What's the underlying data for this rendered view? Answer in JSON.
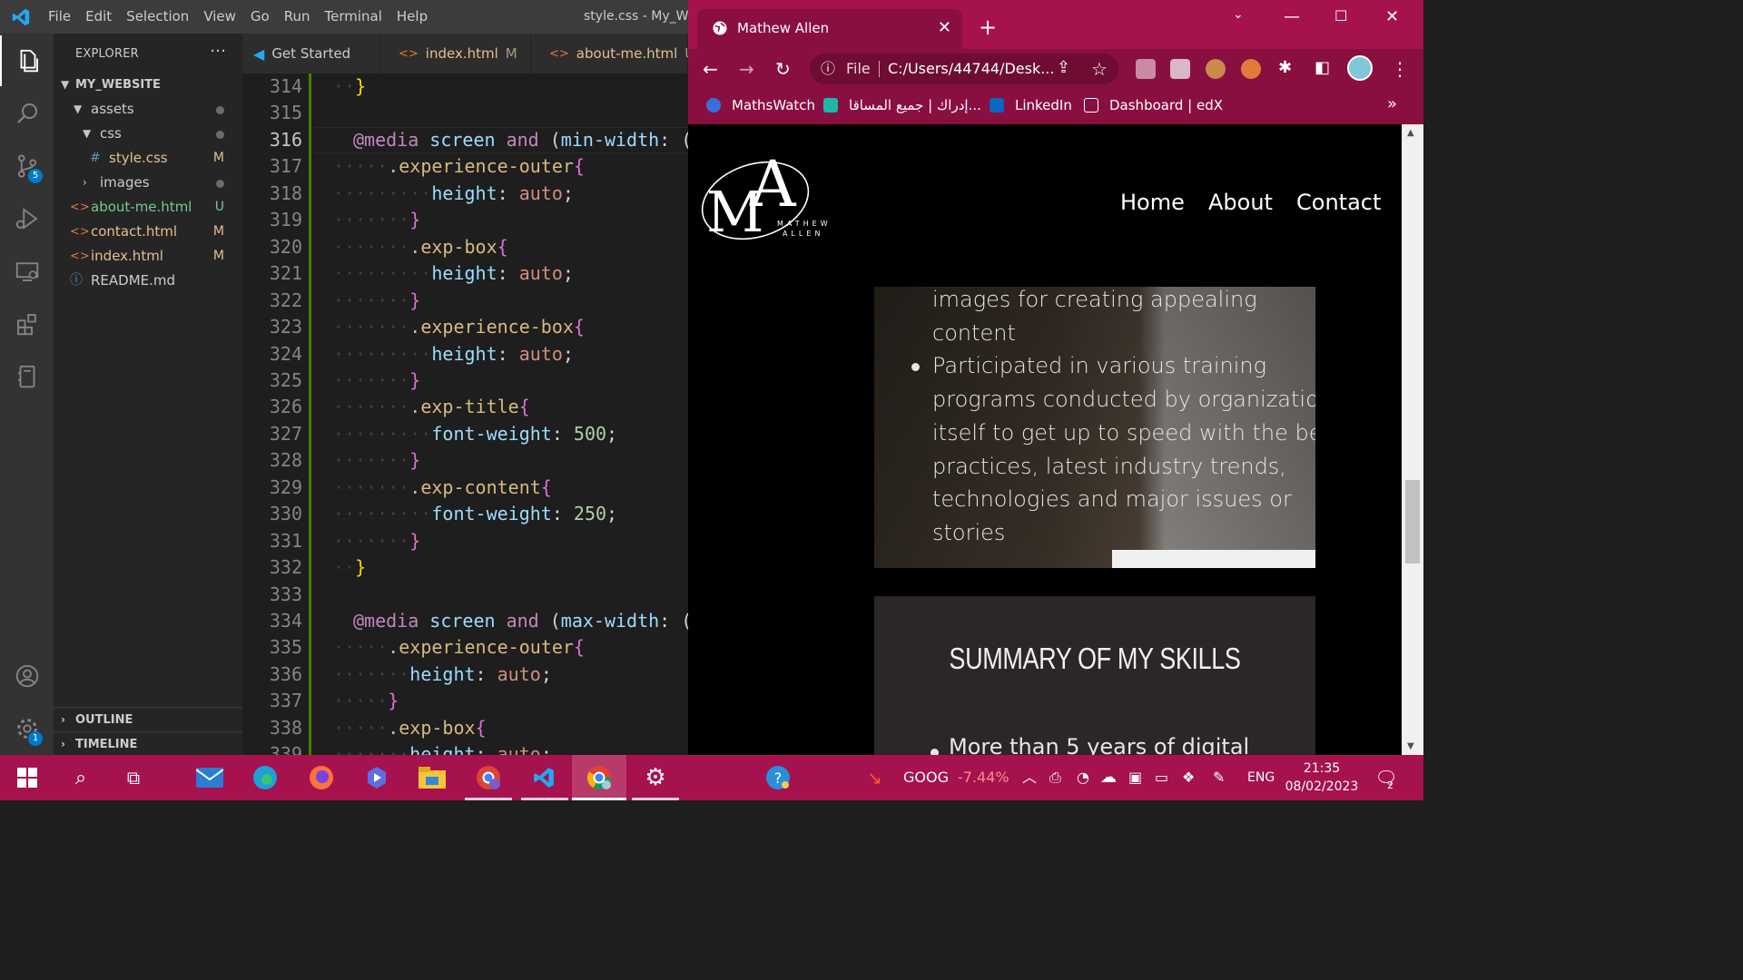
{
  "vscode": {
    "menu": [
      "File",
      "Edit",
      "Selection",
      "View",
      "Go",
      "Run",
      "Terminal",
      "Help"
    ],
    "window_title": "style.css - My_We",
    "explorer_title": "EXPLORER",
    "explorer_more": "···",
    "scm_badge": "5",
    "settings_badge": "1",
    "tree": [
      {
        "label": "MY_WEBSITE",
        "status": ""
      },
      {
        "label": "assets",
        "status": ""
      },
      {
        "label": "css",
        "status": ""
      },
      {
        "label": "style.css",
        "status": "M"
      },
      {
        "label": "images",
        "status": ""
      },
      {
        "label": "about-me.html",
        "status": "U"
      },
      {
        "label": "contact.html",
        "status": "M"
      },
      {
        "label": "index.html",
        "status": "M"
      },
      {
        "label": "README.md",
        "status": ""
      }
    ],
    "sections": [
      "OUTLINE",
      "TIMELINE"
    ],
    "tabs": [
      {
        "label": "Get Started",
        "status": ""
      },
      {
        "label": "index.html",
        "status": "M"
      },
      {
        "label": "about-me.html",
        "status": "U"
      }
    ],
    "line_numbers": [
      "314",
      "315",
      "316",
      "317",
      "318",
      "319",
      "320",
      "321",
      "322",
      "323",
      "324",
      "325",
      "326",
      "327",
      "328",
      "329",
      "330",
      "331",
      "332",
      "333",
      "334",
      "335",
      "336",
      "337",
      "338",
      "339"
    ],
    "code": {
      "l314": "}",
      "l316_at": "@media",
      "l316_rest_a": " screen ",
      "l316_and": "and",
      "l316_paren": " (",
      "l316_prop": "min-width",
      "l316_colon": ": (",
      "l317": ".experience-outer",
      "l318_p": "height",
      "l318_v": "auto",
      "l320": ".exp-box",
      "l321_p": "height",
      "l321_v": "auto",
      "l323": ".experience-box",
      "l324_p": "height",
      "l324_v": "auto",
      "l326": ".exp-title",
      "l327_p": "font-weight",
      "l327_v": "500",
      "l329": ".exp-content",
      "l330_p": "font-weight",
      "l330_v": "250",
      "l332": "}",
      "l334_at": "@media",
      "l334_rest_a": " screen ",
      "l334_and": "and",
      "l334_paren": " (",
      "l334_prop": "max-width",
      "l334_colon": ": (",
      "l335": ".experience-outer",
      "l336_p": "height",
      "l336_v": "auto",
      "l338": ".exp-box",
      "l339_p": "height",
      "l339_v": "auto"
    }
  },
  "chrome": {
    "tab_title": "Mathew Allen",
    "url_scheme": "File",
    "url": "C:/Users/44744/Desk...",
    "bookmarks": [
      "MathsWatch",
      "إدراك | جميع المساقا...",
      "LinkedIn",
      "Dashboard | edX"
    ],
    "bookmarks_more": "»",
    "page": {
      "logo_letters": "MA",
      "logo_name_1": "MATHEW",
      "logo_name_2": "ALLEN",
      "nav": [
        "Home",
        "About",
        "Contact"
      ],
      "para_lines": [
        "images for creating appealing",
        "content",
        "Participated in various training",
        "programs conducted by organization",
        "itself to get up to speed with the best",
        "practices, latest industry trends,",
        "technologies and major issues or",
        "stories"
      ],
      "skills_title": "SUMMARY OF MY SKILLS",
      "skills_item": "More than 5 years of digital"
    }
  },
  "taskbar": {
    "stock_symbol": "GOOG",
    "stock_change": "-7.44%",
    "language": "ENG",
    "time": "21:35",
    "date": "08/02/2023",
    "notif_badge": "2",
    "colors": {
      "accent": "#a5124e",
      "chrome_dark": "#8a0f41",
      "vscode_blue": "#007acc"
    }
  }
}
